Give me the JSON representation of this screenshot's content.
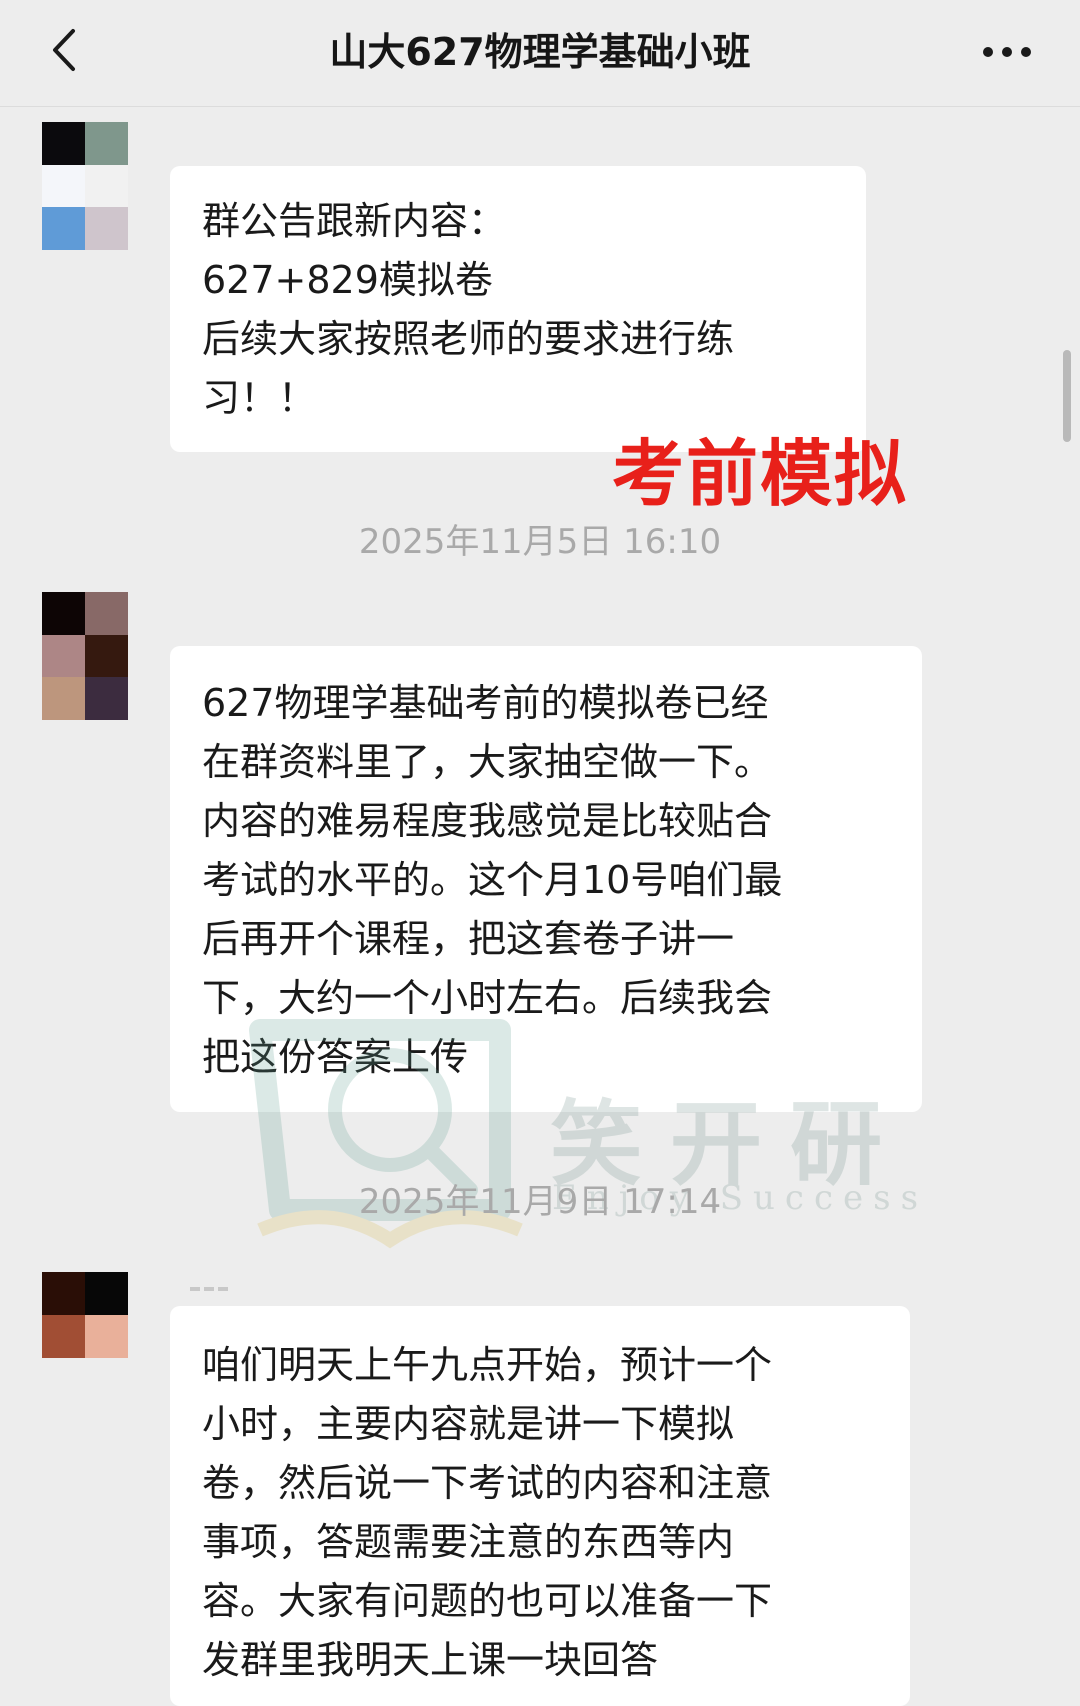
{
  "header": {
    "title": "山大627物理学基础小班",
    "back_icon": "chevron-left-icon",
    "more_icon": "more-dots-icon"
  },
  "messages": [
    {
      "lines": [
        "群公告跟新内容：",
        "627+829模拟卷",
        "后续大家按照老师的要求进行练",
        "习！！"
      ]
    },
    {
      "lines": [
        "627物理学基础考前的模拟卷已经",
        "在群资料里了，大家抽空做一下。",
        "内容的难易程度我感觉是比较贴合",
        "考试的水平的。这个月10号咱们最",
        "后再开个课程，把这套卷子讲一",
        "下，大约一个小时左右。后续我会",
        "把这份答案上传"
      ]
    },
    {
      "lines": [
        "咱们明天上午九点开始，预计一个",
        "小时，主要内容就是讲一下模拟",
        "卷，然后说一下考试的内容和注意",
        "事项，答题需要注意的东西等内",
        "容。大家有问题的也可以准备一下",
        "发群里我明天上课一块回答"
      ]
    }
  ],
  "timestamps": [
    "2025年11月5日 16:10",
    "2025年11月9日 17:14"
  ],
  "annotation": "考前模拟",
  "watermark": {
    "text": "笑开研",
    "subtitle": "Enjoy Success",
    "icon": "magnifier-book-logo-icon"
  },
  "avatars": [
    {
      "colors": [
        "#0b0a0d",
        "#7f978c",
        "#f4f6fa",
        "#f1f1f1",
        "#5f9bd7",
        "#cfc5cc"
      ]
    },
    {
      "colors": [
        "#0d0505",
        "#886967",
        "#ad8686",
        "#35190f",
        "#bd967d",
        "#3c2c3f"
      ]
    },
    {
      "colors": [
        "#2a0e06",
        "#070707",
        "#a14e34",
        "#e9b09a"
      ]
    }
  ],
  "colors": {
    "background": "#ededed",
    "bubble": "#ffffff",
    "annotation": "#e8201a",
    "timestamp": "#a9a9a9"
  }
}
